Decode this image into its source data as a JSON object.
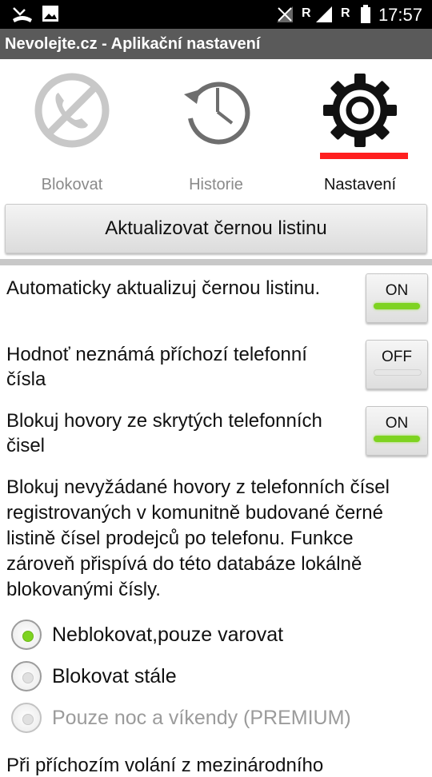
{
  "status_bar": {
    "time": "17:57",
    "carrier_1": "R",
    "carrier_2": "R"
  },
  "title": "Nevolejte.cz - Aplikační nastavení",
  "tabs": [
    {
      "label": "Blokovat",
      "icon": "blocked-call-icon",
      "active": false
    },
    {
      "label": "Historie",
      "icon": "history-icon",
      "active": false
    },
    {
      "label": "Nastavení",
      "icon": "gear-icon",
      "active": true
    }
  ],
  "update_button_label": "Aktualizovat černou listinu",
  "settings": [
    {
      "text": "Automaticky aktualizuj černou listinu.",
      "toggle": "ON"
    },
    {
      "text": "Hodnoť neznámá příchozí telefonní čísla",
      "toggle": "OFF"
    },
    {
      "text": "Blokuj hovory ze skrytých telefonních čisel",
      "toggle": "ON"
    }
  ],
  "description": "Blokuj nevyžádané hovory z telefonních čísel registrovaných v komunitně budované černé listině čísel prodejců po telefonu. Funkce zároveň přispívá do této databáze lokálně blokovanými čísly.",
  "radio_options": [
    {
      "label": "Neblokovat,pouze varovat",
      "selected": true,
      "enabled": true
    },
    {
      "label": "Blokovat stále",
      "selected": false,
      "enabled": true
    },
    {
      "label": "Pouze noc a víkendy (PREMIUM)",
      "selected": false,
      "enabled": false
    }
  ],
  "bottom_text": "Při příchozím volání z mezinárodního",
  "colors": {
    "accent_red": "#ff1f1f",
    "toggle_on_green": "#7ed321",
    "titlebar_gray": "#5a5a5a"
  }
}
